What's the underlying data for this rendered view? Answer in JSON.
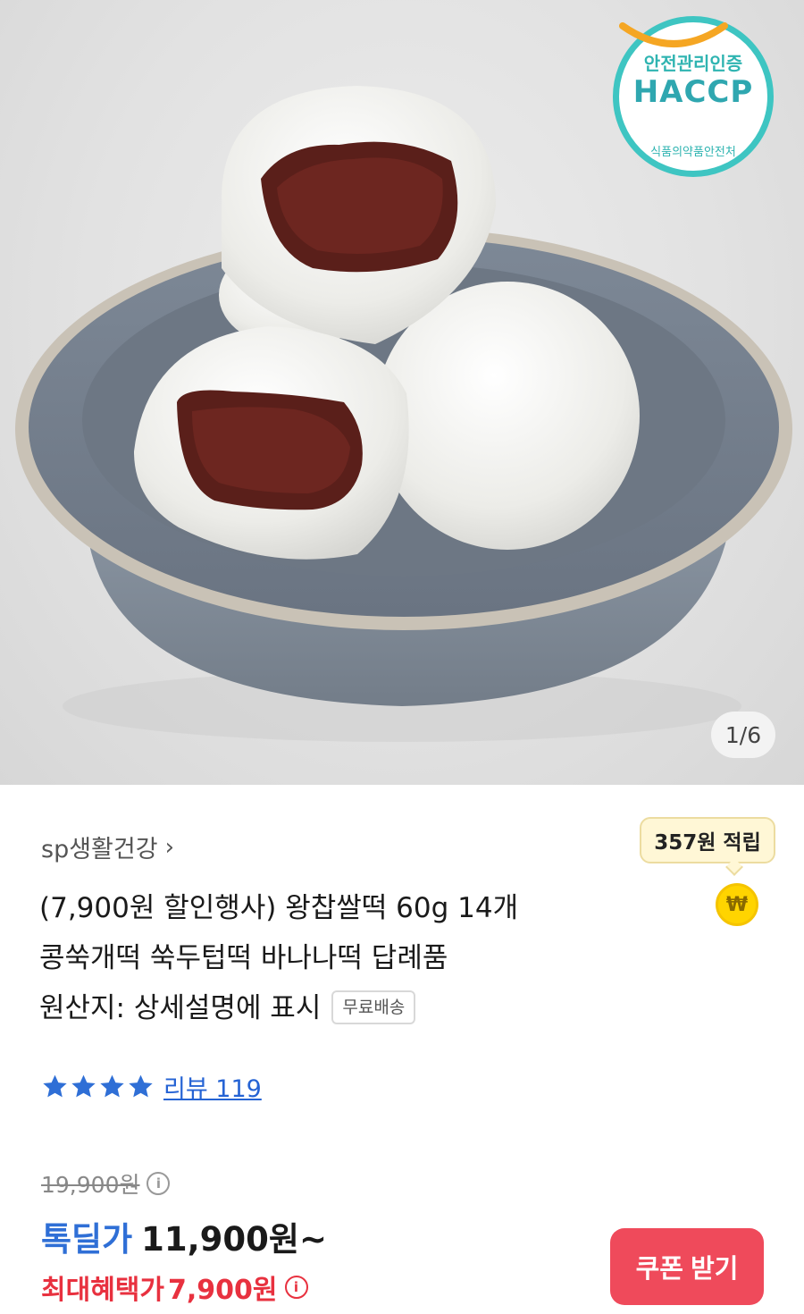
{
  "gallery": {
    "page_indicator": "1/6",
    "current_page": 1,
    "total_pages": 6
  },
  "haccp_badge": {
    "top_text": "안전관리인증",
    "main_text": "HACCP",
    "bottom_text": "식품의약품안전처"
  },
  "product": {
    "seller": "sp생활건강",
    "seller_chevron": "›",
    "points_label": "357원 적립",
    "coin_symbol": "₩",
    "title_lines": [
      "(7,900원 할인행사) 왕찹쌀떡 60g 14개",
      "콩쑥개떡 쑥두텁떡 바나나떡 답례품",
      "원산지: 상세설명에 표시"
    ],
    "free_shipping_badge": "무료배송",
    "rating_stars": 4,
    "review_label": "리뷰 119"
  },
  "price": {
    "original": "19,900원",
    "deal_label": "톡딜가",
    "deal_value": "11,900원~",
    "max_benefit_label": "최대혜택가",
    "max_benefit_value": "7,900원",
    "info_symbol": "i"
  },
  "actions": {
    "coupon_button": "쿠폰 받기"
  },
  "colors": {
    "accent_blue": "#2f6fd6",
    "accent_red": "#e8313f",
    "coupon_button": "#ef4a5b",
    "haccp_teal": "#3ec5c2"
  }
}
